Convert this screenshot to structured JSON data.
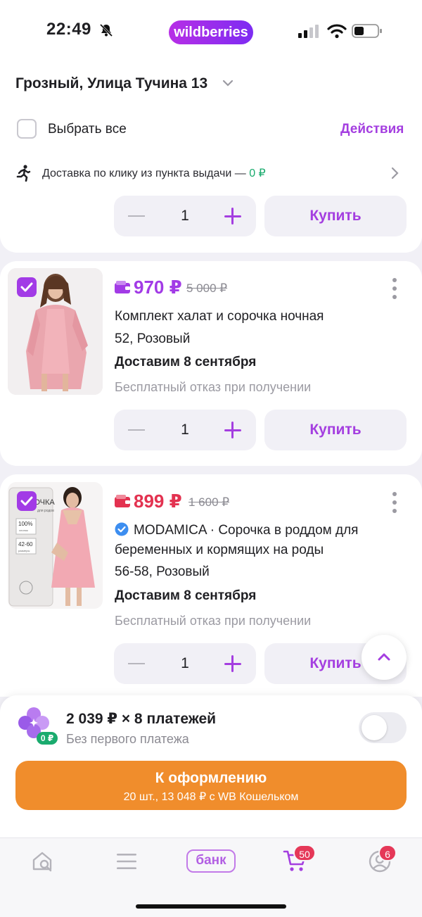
{
  "status_bar": {
    "time": "22:49",
    "brand": "wildberries"
  },
  "header": {
    "address": "Грозный, Улица Тучина 13",
    "select_all": "Выбрать все",
    "actions": "Действия"
  },
  "delivery_row": {
    "text": "Доставка по клику из пункта выдачи — ",
    "price": "0 ₽"
  },
  "items": [
    {
      "quantity": "1",
      "buy_label": "Купить"
    },
    {
      "price": "970 ₽",
      "old_price": "5 000 ₽",
      "title": "Комплект халат и сорочка ночная",
      "variant": "52, Розовый",
      "shipping": "Доставим 8 сентября",
      "return_policy": "Бесплатный отказ при получении",
      "quantity": "1",
      "buy_label": "Купить",
      "price_color": "#a23be6",
      "checked": true
    },
    {
      "price": "899 ₽",
      "old_price": "1 600 ₽",
      "brand": "MODAMICA",
      "title_line1": " · Сорочка в роддом для",
      "title_line2": "беременных и кормящих на роды",
      "variant": "56-58, Розовый",
      "shipping": "Доставим 8 сентября",
      "return_policy": "Бесплатный отказ при получении",
      "quantity": "1",
      "buy_label": "Купить",
      "price_color": "#e33250",
      "checked": true,
      "package_text": [
        "СОРОЧКА",
        "для родов",
        "100%",
        "хлопок",
        "42-60",
        "размеры"
      ]
    }
  ],
  "installment": {
    "title": "2 039 ₽ × 8 платежей",
    "subtitle": "Без первого платежа",
    "badge": "0 ₽",
    "enabled": false
  },
  "checkout": {
    "label": "К оформлению",
    "summary": "20 шт., 13 048 ₽ с WB Кошельком"
  },
  "tabbar": {
    "bank_label": "банк",
    "cart_badge": "50",
    "profile_badge": "6"
  },
  "colors": {
    "accent": "#a43ee0",
    "checkout": "#f08d2c",
    "badge": "#e53858",
    "green": "#1aab6e"
  }
}
